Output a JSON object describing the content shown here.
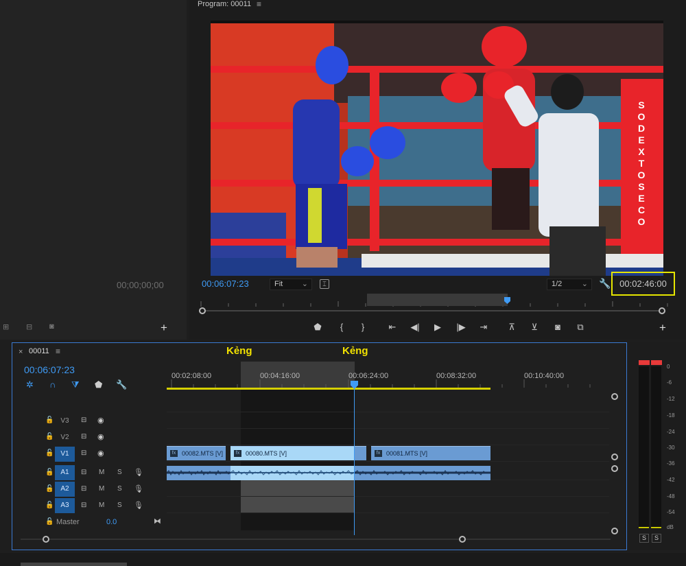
{
  "program": {
    "title": "Program: 00011",
    "timecode": "00:06:07:23",
    "fit": "Fit",
    "resolution": "1/2",
    "duration": "00:02:46:00",
    "ring_banner": "SODEX TOSECO"
  },
  "source": {
    "timecode": "00;00;00;00"
  },
  "timeline": {
    "sequence": "00011",
    "timecode": "00:06:07:23",
    "markers": [
      "Kẻng",
      "Kẻng"
    ],
    "ruler": [
      "00:02:08:00",
      "00:04:16:00",
      "00:06:24:00",
      "00:08:32:00",
      "00:10:40:00"
    ],
    "video_tracks": [
      "V3",
      "V2",
      "V1"
    ],
    "audio_tracks": [
      "A1",
      "A2",
      "A3"
    ],
    "mute": "M",
    "solo": "S",
    "master": {
      "label": "Master",
      "value": "0.0"
    },
    "clips": [
      "00082.MTS [V]",
      "00080.MTS [V]",
      "00081.MTS [V]"
    ],
    "fx_badge": "fx"
  },
  "meters": {
    "scale": [
      "0",
      "-6",
      "-12",
      "-18",
      "-24",
      "-30",
      "-36",
      "-42",
      "-48",
      "-54",
      "dB"
    ],
    "solo_left": "S",
    "solo_right": "S"
  }
}
